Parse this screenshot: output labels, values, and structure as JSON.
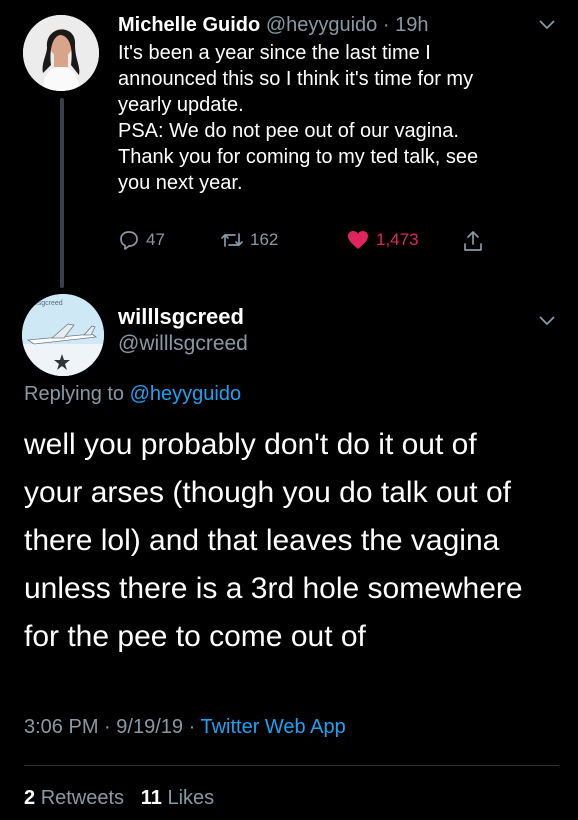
{
  "parent_tweet": {
    "display_name": "Michelle Guido",
    "handle": "@heyyguido",
    "separator": "·",
    "time": "19h",
    "lines": [
      "It's been a year since the last time I",
      "announced this so I think it's time for my",
      "yearly update.",
      "PSA: We do not pee out of our vagina.",
      "Thank you for coming to my ted talk, see",
      "you next year."
    ],
    "actions": {
      "replies": "47",
      "retweets": "162",
      "likes": "1,473"
    },
    "icons": [
      "reply-icon",
      "retweet-icon",
      "heart-icon",
      "share-icon",
      "chevron-down-icon"
    ]
  },
  "reply_tweet": {
    "display_name": "willlsgcreed",
    "handle": "@willlsgcreed",
    "avatar_caption": "willsgcreed",
    "replying_prefix": "Replying to",
    "replying_to": "@heyyguido",
    "lines": [
      "well you probably don't do it out of",
      "your arses (though you do talk out of",
      "there lol) and that leaves the vagina",
      "unless there is a 3rd hole somewhere",
      "for the pee to come out of"
    ],
    "time": "3:06 PM",
    "date": "9/19/19",
    "separator": "·",
    "source": "Twitter Web App",
    "retweet_count": "2",
    "retweet_label": "Retweets",
    "like_count": "11",
    "like_label": "Likes"
  },
  "colors": {
    "background": "#000000",
    "text": "#ffffff",
    "muted": "#8899a6",
    "link": "#1da1f2",
    "like": "#e0245e"
  }
}
